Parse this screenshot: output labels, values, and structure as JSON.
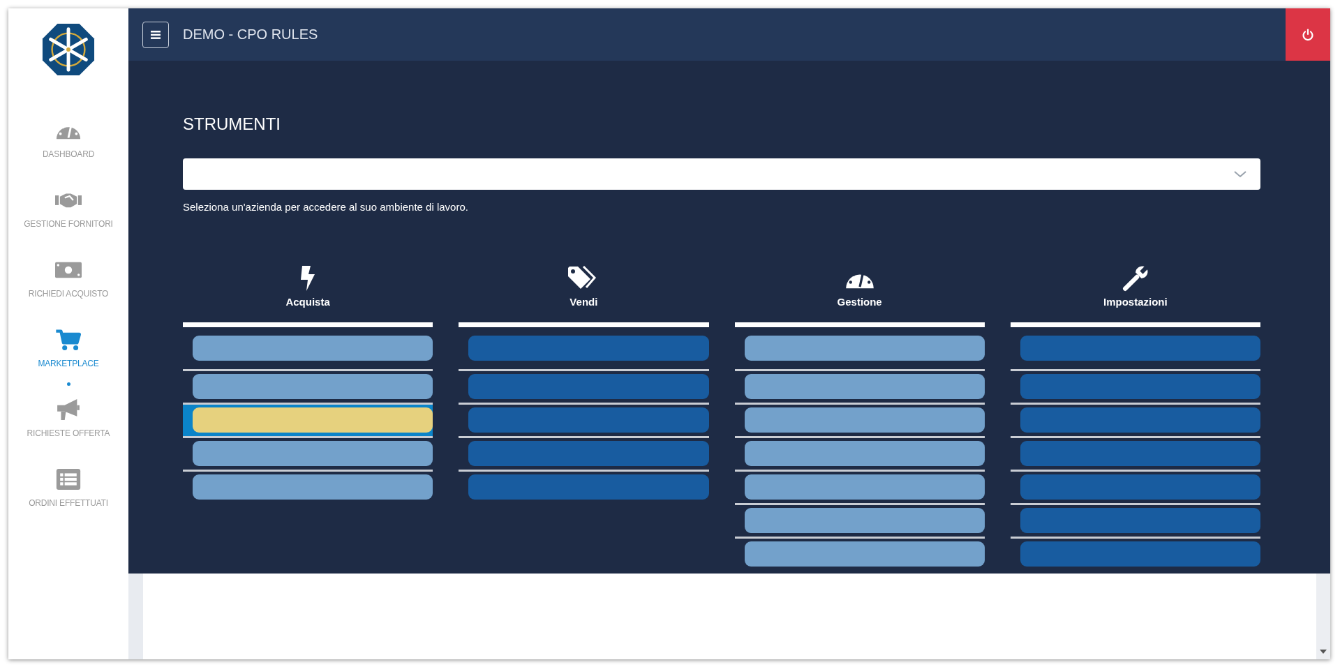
{
  "header": {
    "title": "DEMO - CPO RULES"
  },
  "sidebar": {
    "items": [
      {
        "label": "DASHBOARD",
        "kind": "gauge",
        "selected": false
      },
      {
        "label": "GESTIONE FORNITORI",
        "kind": "handshake",
        "selected": false
      },
      {
        "label": "RICHIEDI ACQUISTO",
        "kind": "bill",
        "selected": false
      },
      {
        "label": "MARKETPLACE",
        "kind": "cart",
        "selected": true
      },
      {
        "label": "RICHIESTE OFFERTA",
        "kind": "megaphone",
        "selected": false
      },
      {
        "label": "ORDINI EFFETTUATI",
        "kind": "list",
        "selected": false
      }
    ]
  },
  "page": {
    "title": "STRUMENTI",
    "hint": "Seleziona un'azienda per accedere al suo ambiente di lavoro."
  },
  "columns": [
    {
      "title": "Acquista",
      "kind": "bolt",
      "color": "#73a1cb",
      "rows": [
        {
          "selected": false
        },
        {
          "selected": false
        },
        {
          "selected": true
        },
        {
          "selected": false
        },
        {
          "selected": false
        }
      ]
    },
    {
      "title": "Vendi",
      "kind": "tags",
      "color": "#185ca0",
      "rows": [
        {
          "selected": false
        },
        {
          "selected": false
        },
        {
          "selected": false
        },
        {
          "selected": false
        },
        {
          "selected": false
        }
      ]
    },
    {
      "title": "Gestione",
      "kind": "gauge",
      "color": "#73a1cb",
      "rows": [
        {
          "selected": false
        },
        {
          "selected": false
        },
        {
          "selected": false
        },
        {
          "selected": false
        },
        {
          "selected": false
        },
        {
          "selected": false
        },
        {
          "selected": false
        }
      ]
    },
    {
      "title": "Impostazioni",
      "kind": "wrench",
      "color": "#185ca0",
      "rows": [
        {
          "selected": false
        },
        {
          "selected": false
        },
        {
          "selected": false
        },
        {
          "selected": false
        },
        {
          "selected": false
        },
        {
          "selected": false
        },
        {
          "selected": false
        }
      ]
    }
  ]
}
